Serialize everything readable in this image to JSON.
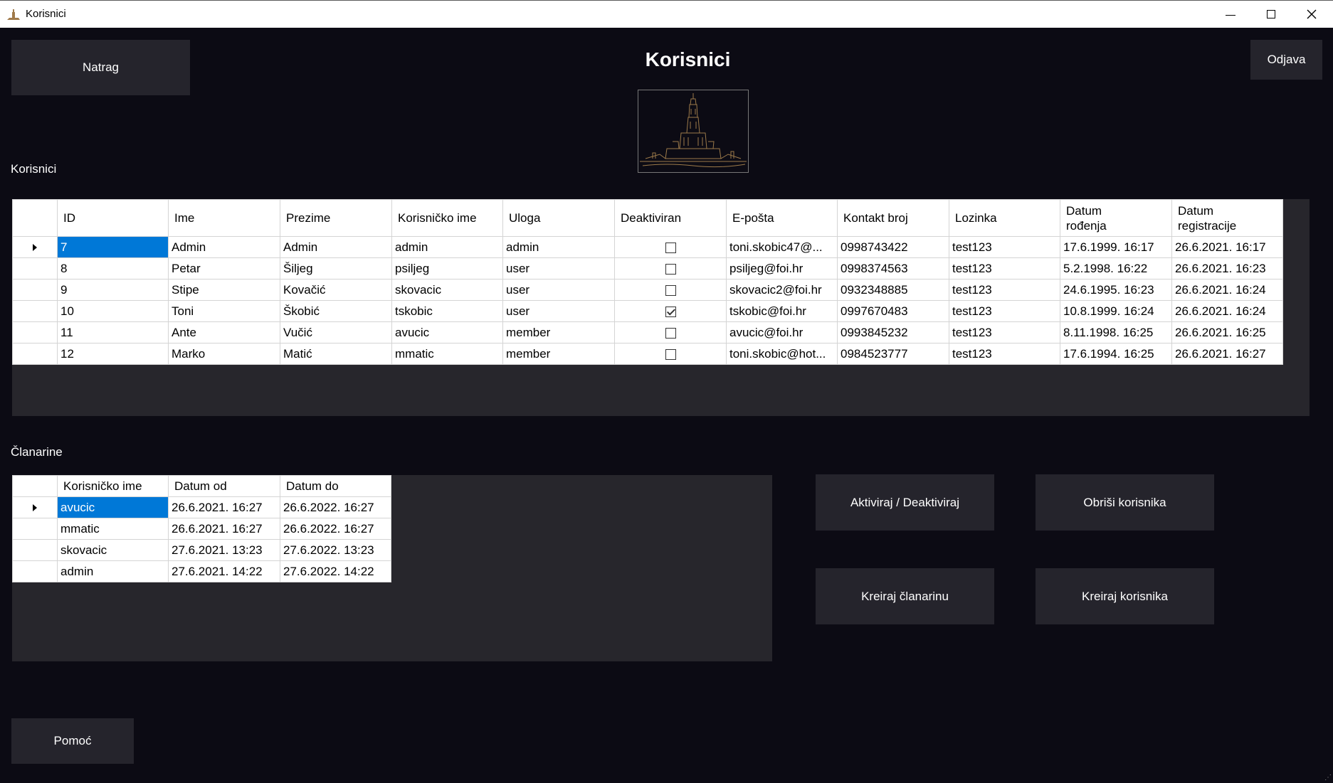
{
  "window": {
    "title": "Korisnici"
  },
  "header": {
    "back_label": "Natrag",
    "title": "Korisnici",
    "logout_label": "Odjava"
  },
  "users": {
    "section_label": "Korisnici",
    "columns": [
      "ID",
      "Ime",
      "Prezime",
      "Korisničko ime",
      "Uloga",
      "Deaktiviran",
      "E-pošta",
      "Kontakt broj",
      "Lozinka",
      [
        "Datum",
        "rođenja"
      ],
      [
        "Datum",
        "registracije"
      ]
    ],
    "rows": [
      {
        "id": "7",
        "ime": "Admin",
        "prezime": "Admin",
        "korisnicko": "admin",
        "uloga": "admin",
        "deaktiviran": false,
        "email": "toni.skobic47@...",
        "kontakt": "0998743422",
        "lozinka": "test123",
        "rodjenje": "17.6.1999. 16:17",
        "registracija": "26.6.2021. 16:17"
      },
      {
        "id": "8",
        "ime": "Petar",
        "prezime": "Šiljeg",
        "korisnicko": "psiljeg",
        "uloga": "user",
        "deaktiviran": false,
        "email": "psiljeg@foi.hr",
        "kontakt": "0998374563",
        "lozinka": "test123",
        "rodjenje": "5.2.1998. 16:22",
        "registracija": "26.6.2021. 16:23"
      },
      {
        "id": "9",
        "ime": "Stipe",
        "prezime": "Kovačić",
        "korisnicko": "skovacic",
        "uloga": "user",
        "deaktiviran": false,
        "email": "skovacic2@foi.hr",
        "kontakt": "0932348885",
        "lozinka": "test123",
        "rodjenje": "24.6.1995. 16:23",
        "registracija": "26.6.2021. 16:24"
      },
      {
        "id": "10",
        "ime": "Toni",
        "prezime": "Škobić",
        "korisnicko": "tskobic",
        "uloga": "user",
        "deaktiviran": true,
        "email": "tskobic@foi.hr",
        "kontakt": "0997670483",
        "lozinka": "test123",
        "rodjenje": "10.8.1999. 16:24",
        "registracija": "26.6.2021. 16:24"
      },
      {
        "id": "11",
        "ime": "Ante",
        "prezime": "Vučić",
        "korisnicko": "avucic",
        "uloga": "member",
        "deaktiviran": false,
        "email": "avucic@foi.hr",
        "kontakt": "0993845232",
        "lozinka": "test123",
        "rodjenje": "8.11.1998. 16:25",
        "registracija": "26.6.2021. 16:25"
      },
      {
        "id": "12",
        "ime": "Marko",
        "prezime": "Matić",
        "korisnicko": "mmatic",
        "uloga": "member",
        "deaktiviran": false,
        "email": "toni.skobic@hot...",
        "kontakt": "0984523777",
        "lozinka": "test123",
        "rodjenje": "17.6.1994. 16:25",
        "registracija": "26.6.2021. 16:27"
      }
    ]
  },
  "memberships": {
    "section_label": "Članarine",
    "columns": [
      "Korisničko ime",
      "Datum od",
      "Datum do"
    ],
    "rows": [
      {
        "korisnicko": "avucic",
        "od": "26.6.2021. 16:27",
        "do": "26.6.2022. 16:27"
      },
      {
        "korisnicko": "mmatic",
        "od": "26.6.2021. 16:27",
        "do": "26.6.2022. 16:27"
      },
      {
        "korisnicko": "skovacic",
        "od": "27.6.2021. 13:23",
        "do": "27.6.2022. 13:23"
      },
      {
        "korisnicko": "admin",
        "od": "27.6.2021. 14:22",
        "do": "27.6.2022. 14:22"
      }
    ]
  },
  "actions": {
    "toggle_label": "Aktiviraj / Deaktiviraj",
    "delete_label": "Obriši korisnika",
    "create_membership_label": "Kreiraj članarinu",
    "create_user_label": "Kreiraj korisnika"
  },
  "footer": {
    "help_label": "Pomoć"
  },
  "colors": {
    "background": "#0c0b14",
    "button": "#25242c",
    "selection": "#0078d7",
    "logo_stroke": "#9c7a4a"
  },
  "icons": {
    "app": "tower-icon",
    "row_pointer": "triangle-right-icon"
  }
}
